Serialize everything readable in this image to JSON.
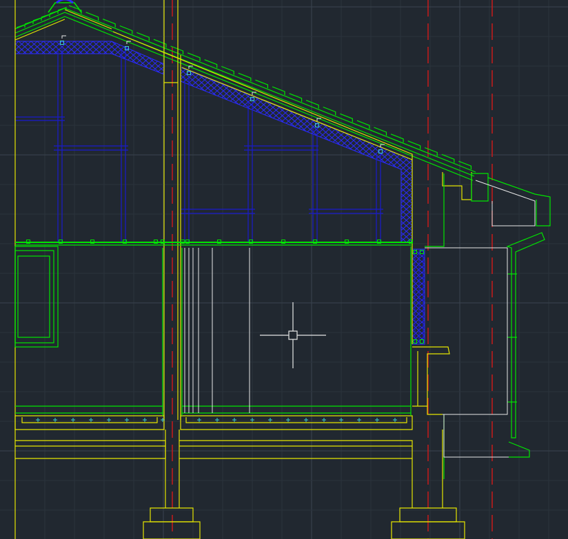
{
  "app": {
    "view": "cad-model-space",
    "background_color": "#212830"
  },
  "colors": {
    "grid_major": "#3a444f",
    "grid_minor": "#2b333c",
    "yellow": "#e6e600",
    "green": "#00e600",
    "blue": "#1a1acc",
    "blue_bright": "#2a2aff",
    "red": "#d41a1a",
    "white": "#e8e8e8",
    "cyan": "#3fd0d0"
  },
  "icons": {
    "crosshair": "crosshair-cursor-icon"
  }
}
